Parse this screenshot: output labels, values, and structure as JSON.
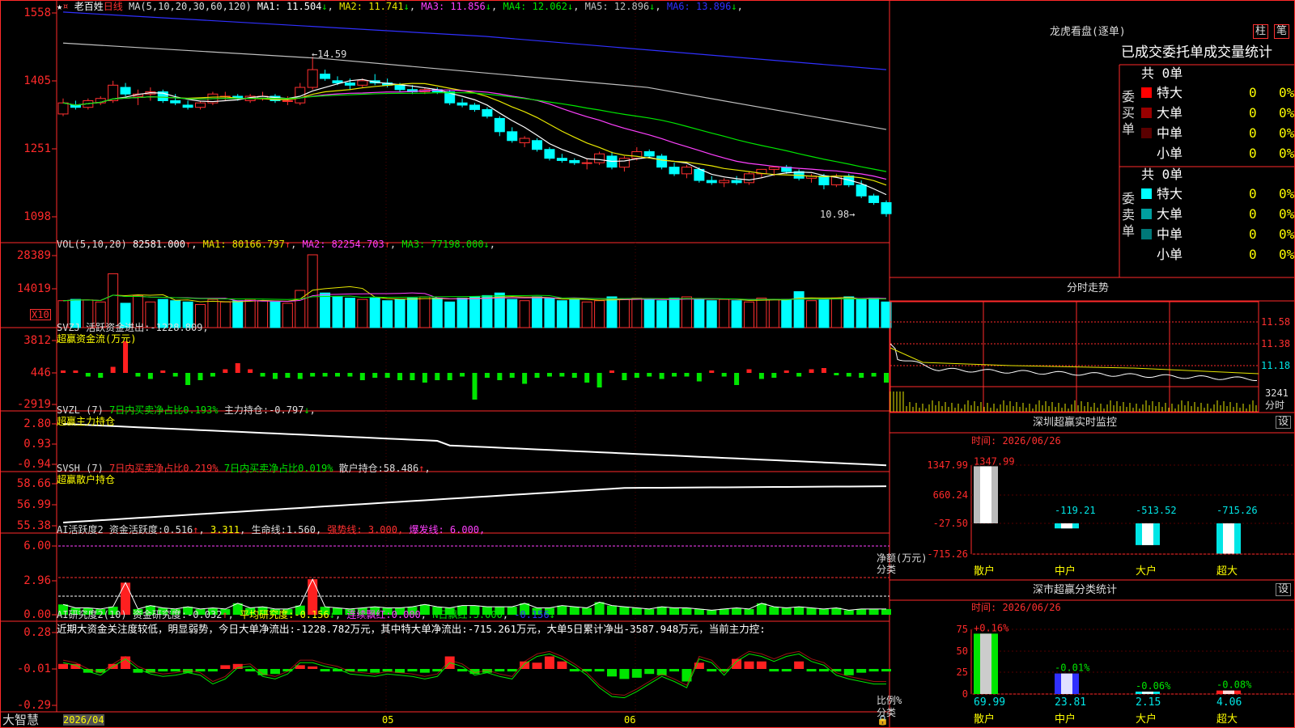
{
  "header": {
    "stars": "★",
    "stock_name": "老百姓",
    "period": "日线",
    "ma_label": "MA(5,10,20,30,60,120)",
    "ma": [
      {
        "name": "MA1:",
        "value": "11.504",
        "arrow": "↓",
        "color": "#ffffff"
      },
      {
        "name": "MA2:",
        "value": "11.741",
        "arrow": "↓",
        "color": "#e6e600"
      },
      {
        "name": "MA3:",
        "value": "11.856",
        "arrow": "↓",
        "color": "#ff40ff"
      },
      {
        "name": "MA4:",
        "value": "12.062",
        "arrow": "↓",
        "color": "#00e600"
      },
      {
        "name": "MA5:",
        "value": "12.896",
        "arrow": "↓",
        "color": "#c0c0c0"
      },
      {
        "name": "MA6:",
        "value": "13.896",
        "arrow": "↓",
        "color": "#3030ff"
      }
    ]
  },
  "price_panel": {
    "y_ticks": [
      "1558",
      "1405",
      "1251",
      "1098"
    ],
    "high_mark": "14.59",
    "low_mark": "10.98"
  },
  "vol_panel": {
    "label": "VOL(5,10,20)",
    "value": "82581.000",
    "arrow": "↑",
    "ma": [
      {
        "name": "MA1:",
        "value": "80166.797",
        "arrow": "↑",
        "color": "#e6e600"
      },
      {
        "name": "MA2:",
        "value": "82254.703",
        "arrow": "↑",
        "color": "#ff40ff"
      },
      {
        "name": "MA3:",
        "value": "77198.000",
        "arrow": "↓",
        "color": "#00e600"
      }
    ],
    "y_ticks": [
      "28389",
      "14019"
    ],
    "unit": "X10"
  },
  "svzj_panel": {
    "label": "SVZJ",
    "item": "活跃资金进出:",
    "value": "-1228.809",
    "suffix": ",",
    "subtitle": "超赢资金流(万元)",
    "y_ticks": [
      "3812",
      "446",
      "-2919"
    ]
  },
  "svzl_panel": {
    "label": "SVZL (7)",
    "green_text": "7日内买卖净占比0.193%",
    "item": "主力持仓:",
    "value": "-0.797",
    "arrow": "↓",
    "suffix": ",",
    "subtitle": "超赢主力持仓",
    "y_ticks": [
      "2.80",
      "0.93",
      "-0.94"
    ]
  },
  "svsh_panel": {
    "label": "SVSH (7)",
    "red_text": "7日内买卖净占比0.219%",
    "green_text": "7日内买卖净占比0.019%",
    "item": "散户持仓:",
    "value": "58.486",
    "arrow": "↑",
    "suffix": ",",
    "subtitle": "超赢散户持仓",
    "y_ticks": [
      "58.66",
      "56.99",
      "55.38"
    ]
  },
  "ai_active_panel": {
    "label": "AI活跃度2",
    "item": "资金活跃度:",
    "value": "0.516",
    "arrow": "↑",
    "value2": "3.311",
    "item2": "生命线:",
    "value3": "1.560",
    "strong": "强势线: 3.000",
    "burst": "爆发线: 6.000",
    "suffix": ",",
    "y_ticks": [
      "6.00",
      "2.96",
      "0.00"
    ]
  },
  "ai_research_panel": {
    "label": "AI研究度2(10)",
    "item": "资金研究度:",
    "value": "-0.032",
    "arrow": "↑",
    "avg": "平均研究度:",
    "avg_value": "-0.156",
    "avg_arrow": "↓",
    "red1": "连续飘红:",
    "red1_value": "0.000",
    "red2": "N日飘红:",
    "red2_value": "3.000",
    "blue_value": "-0.156",
    "blue_arrow": "↓",
    "comment": "近期大资金关注度较低，明显弱势，今日大单净流出:-1228.782万元，其中特大单净流出:-715.261万元，大单5日累计净出-3587.948万元，当前主力控:",
    "y_ticks": [
      "0.28",
      "-0.01",
      "-0.29"
    ]
  },
  "bottom": {
    "brand": "大智慧",
    "dates": [
      "2026/04",
      "05",
      "06"
    ]
  },
  "right_top": {
    "title": "龙虎看盘(逐单)",
    "tab1": "柱",
    "tab2": "笔",
    "header": "已成交委托单成交量统计",
    "buy": {
      "side": "委买单",
      "total": "共 0单",
      "rows": [
        {
          "name": "特大",
          "value": "0",
          "pct": "0%",
          "color": "#ff0000"
        },
        {
          "name": "大单",
          "value": "0",
          "pct": "0%",
          "color": "#9a0000"
        },
        {
          "name": "中单",
          "value": "0",
          "pct": "0%",
          "color": "#5a0000"
        },
        {
          "name": "小单",
          "value": "0",
          "pct": "0%",
          "color": "#000000"
        }
      ]
    },
    "sell": {
      "side": "委卖单",
      "total": "共 0单",
      "rows": [
        {
          "name": "特大",
          "value": "0",
          "pct": "0%",
          "color": "#00ffff"
        },
        {
          "name": "大单",
          "value": "0",
          "pct": "0%",
          "color": "#00a0a0"
        },
        {
          "name": "中单",
          "value": "0",
          "pct": "0%",
          "color": "#007878"
        },
        {
          "name": "小单",
          "value": "0",
          "pct": "0%",
          "color": "#000000"
        }
      ]
    }
  },
  "intraday": {
    "title": "分时走势",
    "y_ticks": [
      "11.58",
      "11.38",
      "11.18"
    ],
    "vol_tick": "3241",
    "unit": "分时"
  },
  "monitor": {
    "title": "深圳超赢实时监控",
    "btn": "设",
    "time_label": "时间: 2026/06/26",
    "y_ticks": [
      "1347.99",
      "660.24",
      "-27.50",
      "-715.26"
    ],
    "ylabel": "净额(万元)",
    "xlabel": "分类"
  },
  "stats": {
    "title": "深市超赢分类统计",
    "btn": "设",
    "time_label": "时间: 2026/06/26",
    "y_ticks": [
      "75",
      "50",
      "25",
      "0"
    ],
    "ylabel": "比例%",
    "xlabel": "分类"
  },
  "chart_data": [
    {
      "type": "bar",
      "title": "深圳超赢实时监控",
      "categories": [
        "散户",
        "中户",
        "大户",
        "超大"
      ],
      "values": [
        1347.99,
        -119.21,
        -513.52,
        -715.26
      ],
      "value_labels": [
        "1347.99",
        "-119.21",
        "-513.52",
        "-715.26"
      ],
      "ylabel": "净额(万元)",
      "xlabel": "分类",
      "ylim": [
        -715.26,
        1347.99
      ]
    },
    {
      "type": "bar",
      "title": "深市超赢分类统计",
      "categories": [
        "散户",
        "中户",
        "大户",
        "超大"
      ],
      "values": [
        69.99,
        23.81,
        2.15,
        4.06
      ],
      "top_labels": [
        "+0.16%",
        "-0.01%",
        "-0.06%",
        "-0.08%"
      ],
      "bottom_labels": [
        "69.99",
        "23.81",
        "2.15",
        "4.06"
      ],
      "ylabel": "比例%",
      "xlabel": "分类",
      "ylim": [
        0,
        75
      ]
    },
    {
      "type": "line",
      "title": "日线",
      "ohlc": [
        [
          13.3,
          13.65,
          13.25,
          13.55
        ],
        [
          13.5,
          13.6,
          13.4,
          13.45
        ],
        [
          13.45,
          13.65,
          13.4,
          13.6
        ],
        [
          13.55,
          13.7,
          13.5,
          13.65
        ],
        [
          13.6,
          14.05,
          13.55,
          13.95
        ],
        [
          13.9,
          14.0,
          13.7,
          13.75
        ],
        [
          13.7,
          13.85,
          13.5,
          13.75
        ],
        [
          13.75,
          13.9,
          13.6,
          13.8
        ],
        [
          13.8,
          13.85,
          13.55,
          13.6
        ],
        [
          13.6,
          13.75,
          13.5,
          13.55
        ],
        [
          13.5,
          13.6,
          13.4,
          13.45
        ],
        [
          13.45,
          13.6,
          13.4,
          13.55
        ],
        [
          13.55,
          13.8,
          13.5,
          13.75
        ],
        [
          13.7,
          13.8,
          13.6,
          13.7
        ],
        [
          13.7,
          13.75,
          13.6,
          13.65
        ],
        [
          13.6,
          13.75,
          13.55,
          13.7
        ],
        [
          13.65,
          13.8,
          13.6,
          13.7
        ],
        [
          13.7,
          13.75,
          13.55,
          13.6
        ],
        [
          13.6,
          13.7,
          13.5,
          13.6
        ],
        [
          13.55,
          14.0,
          13.5,
          13.9
        ],
        [
          13.9,
          14.59,
          13.85,
          14.3
        ],
        [
          14.2,
          14.3,
          14.05,
          14.1
        ],
        [
          14.05,
          14.15,
          13.95,
          14.0
        ],
        [
          14.0,
          14.1,
          13.85,
          13.95
        ],
        [
          13.95,
          14.1,
          13.9,
          14.05
        ],
        [
          14.05,
          14.2,
          13.95,
          14.0
        ],
        [
          14.0,
          14.1,
          13.9,
          13.95
        ],
        [
          13.95,
          14.0,
          13.8,
          13.85
        ],
        [
          13.85,
          13.95,
          13.75,
          13.8
        ],
        [
          13.8,
          13.9,
          13.75,
          13.85
        ],
        [
          13.85,
          13.9,
          13.75,
          13.8
        ],
        [
          13.8,
          13.85,
          13.5,
          13.55
        ],
        [
          13.55,
          13.65,
          13.45,
          13.5
        ],
        [
          13.5,
          13.55,
          13.35,
          13.4
        ],
        [
          13.4,
          13.45,
          13.2,
          13.25
        ],
        [
          13.2,
          13.25,
          12.8,
          12.9
        ],
        [
          12.9,
          13.0,
          12.65,
          12.7
        ],
        [
          12.65,
          12.8,
          12.55,
          12.75
        ],
        [
          12.7,
          12.75,
          12.45,
          12.5
        ],
        [
          12.5,
          12.55,
          12.25,
          12.3
        ],
        [
          12.3,
          12.4,
          12.2,
          12.25
        ],
        [
          12.25,
          12.3,
          12.15,
          12.2
        ],
        [
          12.2,
          12.3,
          12.05,
          12.2
        ],
        [
          12.2,
          12.45,
          12.15,
          12.4
        ],
        [
          12.35,
          12.45,
          12.05,
          12.1
        ],
        [
          12.1,
          12.35,
          12.0,
          12.3
        ],
        [
          12.3,
          12.55,
          12.25,
          12.45
        ],
        [
          12.45,
          12.5,
          12.3,
          12.35
        ],
        [
          12.35,
          12.4,
          12.05,
          12.1
        ],
        [
          12.1,
          12.2,
          11.9,
          11.95
        ],
        [
          11.95,
          12.15,
          11.85,
          12.1
        ],
        [
          12.05,
          12.1,
          11.75,
          11.8
        ],
        [
          11.8,
          11.9,
          11.7,
          11.75
        ],
        [
          11.75,
          11.85,
          11.65,
          11.8
        ],
        [
          11.8,
          11.9,
          11.7,
          11.75
        ],
        [
          11.75,
          12.0,
          11.7,
          11.95
        ],
        [
          11.95,
          12.05,
          11.85,
          12.05
        ],
        [
          12.05,
          12.1,
          11.9,
          12.1
        ],
        [
          12.1,
          12.15,
          11.95,
          12.0
        ],
        [
          12.0,
          12.05,
          11.8,
          11.85
        ],
        [
          11.85,
          11.95,
          11.75,
          11.9
        ],
        [
          11.9,
          11.95,
          11.6,
          11.7
        ],
        [
          11.7,
          11.95,
          11.65,
          11.9
        ],
        [
          11.9,
          11.95,
          11.65,
          11.7
        ],
        [
          11.7,
          11.8,
          11.4,
          11.45
        ],
        [
          11.45,
          11.5,
          11.25,
          11.3
        ],
        [
          11.3,
          11.35,
          10.98,
          11.05
        ]
      ],
      "volume": [
        10500,
        11000,
        10800,
        10000,
        21000,
        9500,
        12500,
        10000,
        11000,
        10500,
        10000,
        9000,
        11000,
        10000,
        10500,
        11000,
        10500,
        10000,
        9500,
        14500,
        28389,
        13500,
        12000,
        11500,
        11000,
        11500,
        10500,
        11000,
        11500,
        12000,
        11500,
        10000,
        11500,
        12000,
        12500,
        13500,
        11000,
        10500,
        12000,
        11500,
        10500,
        11000,
        10000,
        10500,
        12000,
        11000,
        11500,
        11000,
        10500,
        11500,
        12000,
        11000,
        10500,
        11000,
        10500,
        10000,
        11500,
        11000,
        11000,
        14019,
        10500,
        11000,
        11500,
        12000,
        11000,
        11500,
        10000
      ]
    }
  ]
}
